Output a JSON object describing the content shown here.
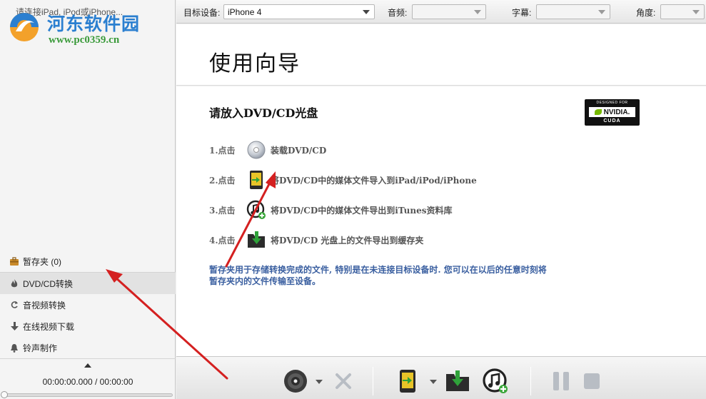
{
  "sidebar": {
    "device_message": "请连接iPad, iPod或iPhone...",
    "watermark": {
      "title": "河东软件园",
      "url": "www.pc0359.cn"
    },
    "cache_label": "暂存夹 (0)",
    "menu": [
      {
        "label": "DVD/CD转换",
        "icon": "flame-icon",
        "active": true
      },
      {
        "label": "音视频转换",
        "icon": "convert-arrows-icon",
        "active": false
      },
      {
        "label": "在线视频下载",
        "icon": "download-arrow-icon",
        "active": false
      },
      {
        "label": "铃声制作",
        "icon": "bell-icon",
        "active": false
      }
    ],
    "time_display": "00:00:00.000 / 00:00:00",
    "progress": 0
  },
  "topbar": {
    "target_device_label": "目标设备:",
    "target_device_value": "iPhone 4",
    "audio_label": "音频:",
    "audio_value": "",
    "subtitle_label": "字幕:",
    "subtitle_value": "",
    "angle_label": "角度:",
    "angle_value": ""
  },
  "wizard": {
    "title": "使用向导",
    "heading": "请放入DVD/CD光盘",
    "badge": {
      "top": "DESIGNED FOR",
      "brand": "NVIDIA.",
      "bottom": "CUDA"
    },
    "steps": [
      {
        "num": "1.点击",
        "icon": "disc-icon",
        "text": "装载DVD/CD"
      },
      {
        "num": "2.点击",
        "icon": "import-device-icon",
        "text": "将DVD/CD中的媒体文件导入到iPad/iPod/iPhone"
      },
      {
        "num": "3.点击",
        "icon": "itunes-add-icon",
        "text": "将DVD/CD中的媒体文件导出到iTunes资料库"
      },
      {
        "num": "4.点击",
        "icon": "folder-download-icon",
        "text": "将DVD/CD 光盘上的文件导出到缓存夹"
      }
    ],
    "info_line1": "暂存夹用于存储转换完成的文件, 特别是在未连接目标设备时. 您可以在以后的任意时刻将",
    "info_line2": "暂存夹内的文件传输至设备。"
  },
  "colors": {
    "info_text": "#3a5fa0",
    "annotation_arrow": "#d42020",
    "watermark_blue": "#2b7fd0",
    "watermark_green": "#3a9a3a"
  }
}
